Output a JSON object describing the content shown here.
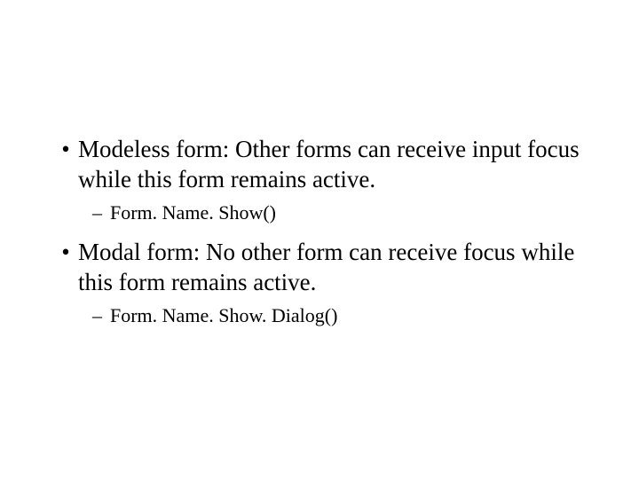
{
  "bullets": [
    {
      "text": "Modeless form: Other forms can receive input focus while this form remains active.",
      "sub": "Form. Name. Show()"
    },
    {
      "text": "Modal form: No other form can receive focus while this form remains active.",
      "sub": "Form. Name. Show. Dialog()"
    }
  ]
}
